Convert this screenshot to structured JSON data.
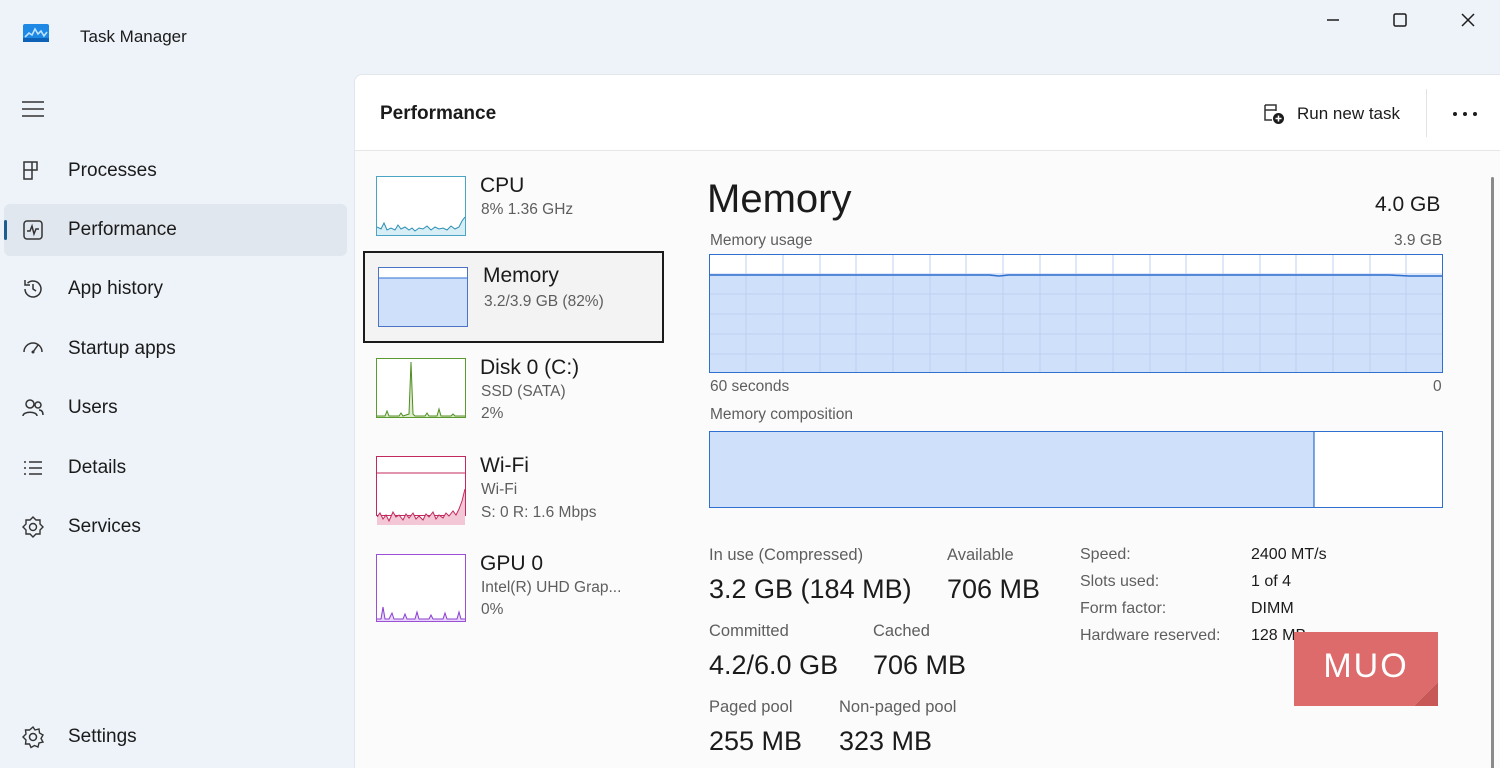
{
  "window": {
    "title": "Task Manager",
    "icon": "task-manager-icon",
    "controls": [
      "minimize-icon",
      "maximize-icon",
      "close-icon"
    ]
  },
  "sidebar": {
    "menu_icon": "hamburger-icon",
    "items": [
      {
        "label": "Processes",
        "icon": "processes-icon",
        "active": false
      },
      {
        "label": "Performance",
        "icon": "performance-icon",
        "active": true
      },
      {
        "label": "App history",
        "icon": "history-icon",
        "active": false
      },
      {
        "label": "Startup apps",
        "icon": "startup-icon",
        "active": false
      },
      {
        "label": "Users",
        "icon": "users-icon",
        "active": false
      },
      {
        "label": "Details",
        "icon": "details-icon",
        "active": false
      },
      {
        "label": "Services",
        "icon": "services-icon",
        "active": false
      }
    ],
    "settings": {
      "label": "Settings",
      "icon": "gear-icon"
    }
  },
  "header": {
    "title": "Performance",
    "run_new_task": "Run new task",
    "more_icon": "more-icon"
  },
  "devices": [
    {
      "name": "CPU",
      "lines": [
        "8%  1.36 GHz"
      ],
      "color": "#4aa4c4",
      "selected": false
    },
    {
      "name": "Memory",
      "lines": [
        "3.2/3.9 GB (82%)"
      ],
      "color": "#6a8fd8",
      "selected": true,
      "usage_fraction": 0.82
    },
    {
      "name": "Disk 0 (C:)",
      "lines": [
        "SSD (SATA)",
        "2%"
      ],
      "color": "#5c9a2e",
      "selected": false
    },
    {
      "name": "Wi-Fi",
      "lines": [
        "Wi-Fi",
        "S: 0  R: 1.6 Mbps"
      ],
      "color": "#c22a5e",
      "selected": false
    },
    {
      "name": "GPU 0",
      "lines": [
        "Intel(R) UHD Grap...",
        "0%"
      ],
      "color": "#9b4fd6",
      "selected": false
    }
  ],
  "memory": {
    "title": "Memory",
    "total": "4.0 GB",
    "usage_label": "Memory usage",
    "usage_max": "3.9 GB",
    "time_label": "60 seconds",
    "zero_label": "0",
    "composition_label": "Memory composition",
    "in_use_fraction": 0.82,
    "stats": {
      "in_use_label": "In use (Compressed)",
      "in_use_value": "3.2 GB (184 MB)",
      "available_label": "Available",
      "available_value": "706 MB",
      "committed_label": "Committed",
      "committed_value": "4.2/6.0 GB",
      "cached_label": "Cached",
      "cached_value": "706 MB",
      "paged_label": "Paged pool",
      "paged_value": "255 MB",
      "nonpaged_label": "Non-paged pool",
      "nonpaged_value": "323 MB"
    },
    "specs": {
      "speed_label": "Speed:",
      "speed_value": "2400 MT/s",
      "slots_label": "Slots used:",
      "slots_value": "1 of 4",
      "form_label": "Form factor:",
      "form_value": "DIMM",
      "reserved_label": "Hardware reserved:",
      "reserved_value": "128 MB"
    }
  },
  "watermark": {
    "text": "MUO",
    "color": "#dd6b6b"
  },
  "colors": {
    "accent": "#1c5f8e",
    "memory_line": "#2f6fd0",
    "memory_fill": "#cfe0fb"
  }
}
